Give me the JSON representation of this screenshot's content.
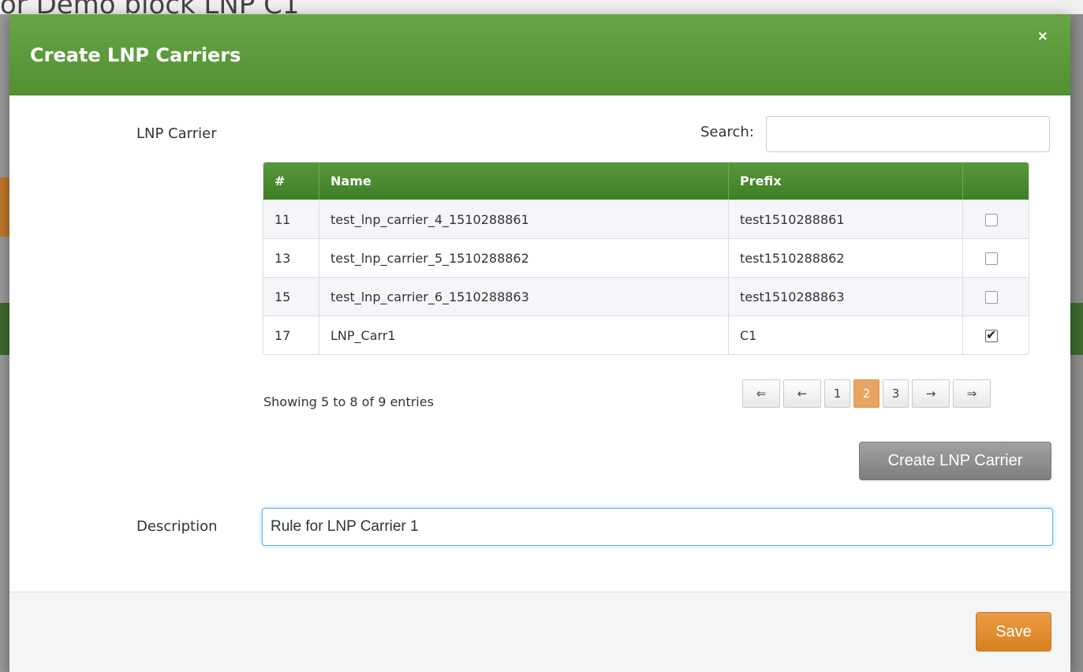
{
  "background": {
    "title_fragment": "or Demo block LNP C1"
  },
  "modal": {
    "title": "Create LNP Carriers",
    "close_label": "×",
    "carrier_label": "LNP Carrier",
    "search_label": "Search:",
    "search_value": "",
    "table": {
      "headers": [
        "#",
        "Name",
        "Prefix",
        ""
      ],
      "rows": [
        {
          "id": "11",
          "name": "test_lnp_carrier_4_1510288861",
          "prefix": "test1510288861",
          "checked": false
        },
        {
          "id": "13",
          "name": "test_lnp_carrier_5_1510288862",
          "prefix": "test1510288862",
          "checked": false
        },
        {
          "id": "15",
          "name": "test_lnp_carrier_6_1510288863",
          "prefix": "test1510288863",
          "checked": false
        },
        {
          "id": "17",
          "name": "LNP_Carr1",
          "prefix": "C1",
          "checked": true
        }
      ]
    },
    "info": "Showing 5 to 8 of 9 entries",
    "pagination": {
      "first": "⇐",
      "prev": "←",
      "pages": [
        "1",
        "2",
        "3"
      ],
      "active_page": "2",
      "next": "→",
      "last": "⇒"
    },
    "create_button": "Create LNP Carrier",
    "description_label": "Description",
    "description_value": "Rule for LNP Carrier 1",
    "save_button": "Save"
  },
  "colors": {
    "header_green": "#5a9a3a",
    "accent_orange": "#e0912f",
    "active_page": "#e7a462"
  }
}
